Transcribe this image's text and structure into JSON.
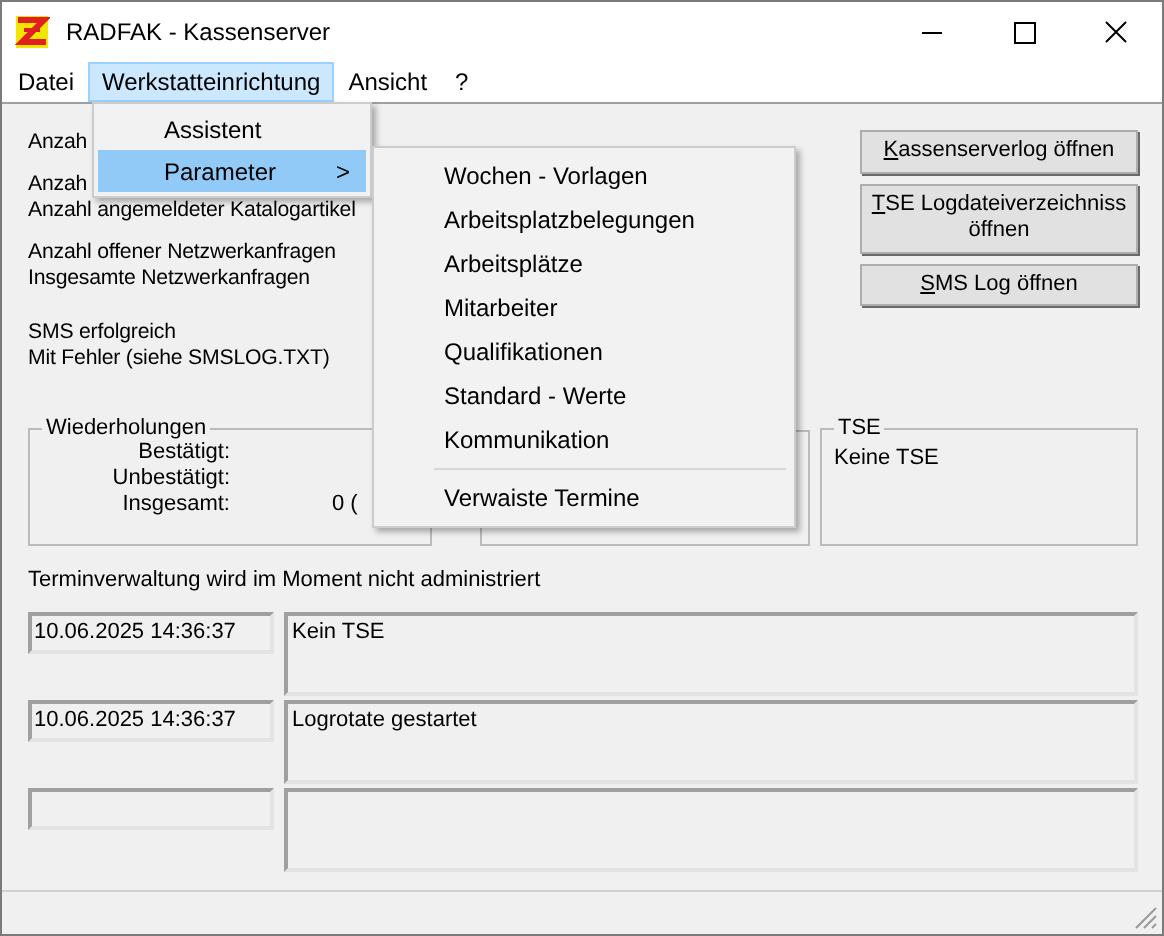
{
  "window": {
    "title": "RADFAK - Kassenserver"
  },
  "menu_bar": [
    {
      "label": "Datei",
      "selected": false
    },
    {
      "label": "Werkstatteinrichtung",
      "selected": true
    },
    {
      "label": "Ansicht",
      "selected": false
    },
    {
      "label": "?",
      "selected": false
    }
  ],
  "dropdown": {
    "items": [
      {
        "label": "Assistent",
        "selected": false
      },
      {
        "label": "Parameter",
        "selected": true,
        "arrow": ">"
      }
    ]
  },
  "submenu": {
    "items": [
      {
        "kind": "item",
        "label": "Wochen - Vorlagen"
      },
      {
        "kind": "item",
        "label": "Arbeitsplatzbelegungen"
      },
      {
        "kind": "item",
        "label": "Arbeitsplätze"
      },
      {
        "kind": "item",
        "label": "Mitarbeiter"
      },
      {
        "kind": "item",
        "label": "Qualifikationen"
      },
      {
        "kind": "item",
        "label": "Standard - Werte"
      },
      {
        "kind": "item",
        "label": "Kommunikation"
      },
      {
        "kind": "separator"
      },
      {
        "kind": "item",
        "label": "Verwaiste Termine"
      }
    ]
  },
  "stats": [
    {
      "lines": [
        {
          "label": "Anzah"
        }
      ]
    },
    {
      "lines": [
        {
          "label": "Anzah"
        },
        {
          "label": "Anzahl angemeldeter Katalogartikel"
        }
      ]
    },
    {
      "lines": [
        {
          "label": "Anzahl offener Netzwerkanfragen"
        },
        {
          "label": "Insgesamte Netzwerkanfragen"
        }
      ]
    },
    {
      "lines": [
        {
          "label": "SMS erfolgreich"
        },
        {
          "label": "Mit Fehler (siehe SMSLOG.TXT)"
        }
      ]
    }
  ],
  "buttons": [
    {
      "accel": "K",
      "rest": "assenserverlog öffnen"
    },
    {
      "accel": "T",
      "rest": "SE Logdateiverzeichniss öffnen"
    },
    {
      "accel": "S",
      "rest": "MS Log öffnen"
    }
  ],
  "repeats": {
    "title": "Wiederholungen",
    "rows": [
      {
        "label": "Bestätigt:"
      },
      {
        "label": "Unbestätigt:"
      },
      {
        "label": "Insgesamt:",
        "value": "0 ("
      }
    ]
  },
  "tse": {
    "title": "TSE",
    "text": "Keine TSE"
  },
  "status_message": "Terminverwaltung wird im Moment nicht administriert",
  "log": [
    {
      "kind": "entry",
      "time": "10.06.2025 14:36:37",
      "message": "Kein TSE"
    },
    {
      "kind": "entry",
      "time": "10.06.2025 14:36:37",
      "message": "Logrotate gestartet"
    },
    {
      "kind": "empty"
    }
  ]
}
